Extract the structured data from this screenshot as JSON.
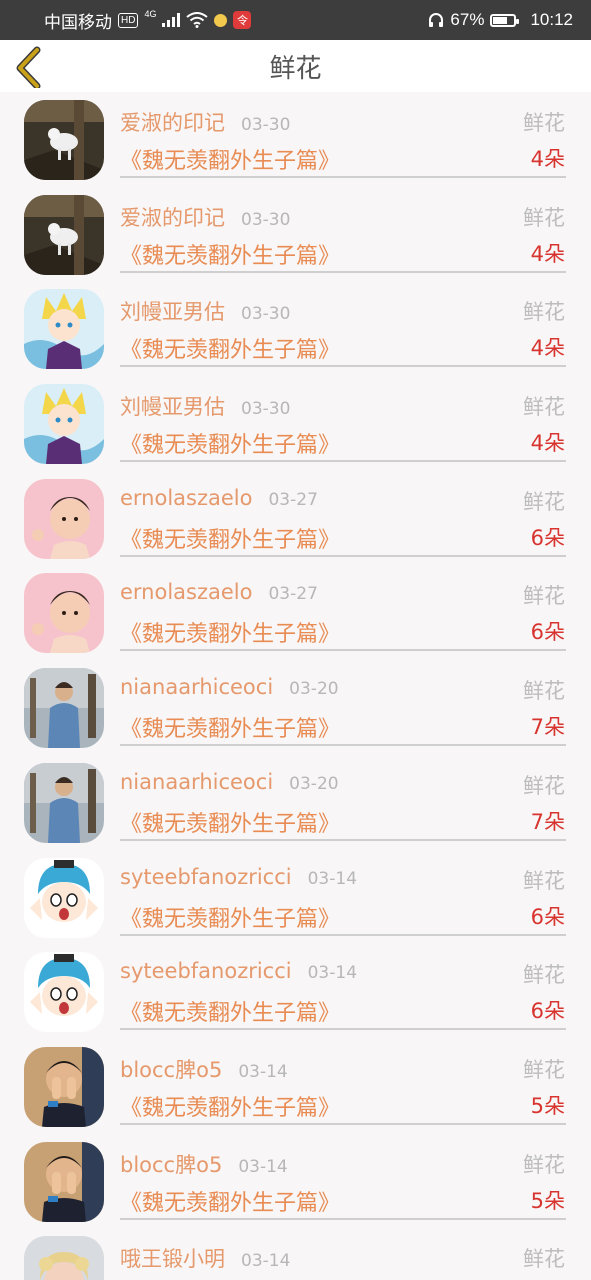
{
  "status_bar": {
    "carrier": "中国移动",
    "hd_badge": "HD",
    "network_type": "4G",
    "battery_percent": "67%",
    "battery_level": 0.67,
    "time": "10:12",
    "app_badge": "令"
  },
  "header": {
    "title": "鲜花",
    "back_icon": "chevron-left-icon"
  },
  "colors": {
    "username": "#e5996c",
    "book_title": "#e88c54",
    "count": "#d8342f",
    "muted": "#b7b7b7",
    "back_icon": "#c9a21a"
  },
  "rows": [
    {
      "username": "爱淑的印记",
      "date": "03-30",
      "type": "鲜花",
      "book": "《魏无羡翻外生子篇》",
      "count": "4朵",
      "avatar": "goat-cliff"
    },
    {
      "username": "爱淑的印记",
      "date": "03-30",
      "type": "鲜花",
      "book": "《魏无羡翻外生子篇》",
      "count": "4朵",
      "avatar": "goat-cliff"
    },
    {
      "username": "刘幔亚男估",
      "date": "03-30",
      "type": "鲜花",
      "book": "《魏无羡翻外生子篇》",
      "count": "4朵",
      "avatar": "anime-blond"
    },
    {
      "username": "刘幔亚男估",
      "date": "03-30",
      "type": "鲜花",
      "book": "《魏无羡翻外生子篇》",
      "count": "4朵",
      "avatar": "anime-blond"
    },
    {
      "username": "ernolaszaelo",
      "date": "03-27",
      "type": "鲜花",
      "book": "《魏无羡翻外生子篇》",
      "count": "6朵",
      "avatar": "toddler-pink"
    },
    {
      "username": "ernolaszaelo",
      "date": "03-27",
      "type": "鲜花",
      "book": "《魏无羡翻外生子篇》",
      "count": "6朵",
      "avatar": "toddler-pink"
    },
    {
      "username": "nianaarhiceoci",
      "date": "03-20",
      "type": "鲜花",
      "book": "《魏无羡翻外生子篇》",
      "count": "7朵",
      "avatar": "man-outdoors"
    },
    {
      "username": "nianaarhiceoci",
      "date": "03-20",
      "type": "鲜花",
      "book": "《魏无羡翻外生子篇》",
      "count": "7朵",
      "avatar": "man-outdoors"
    },
    {
      "username": "syteebfanozricci",
      "date": "03-14",
      "type": "鲜花",
      "book": "《魏无羡翻外生子篇》",
      "count": "6朵",
      "avatar": "cartoon-blue-hair"
    },
    {
      "username": "syteebfanozricci",
      "date": "03-14",
      "type": "鲜花",
      "book": "《魏无羡翻外生子篇》",
      "count": "6朵",
      "avatar": "cartoon-blue-hair"
    },
    {
      "username": "blocc脾o5",
      "date": "03-14",
      "type": "鲜花",
      "book": "《魏无羡翻外生子篇》",
      "count": "5朵",
      "avatar": "kid-covering-face"
    },
    {
      "username": "blocc脾o5",
      "date": "03-14",
      "type": "鲜花",
      "book": "《魏无羡翻外生子篇》",
      "count": "5朵",
      "avatar": "kid-covering-face"
    },
    {
      "username": "哦王锻小明",
      "date": "03-14",
      "type": "鲜花",
      "book": "",
      "count": "",
      "avatar": "blonde-girl"
    }
  ]
}
